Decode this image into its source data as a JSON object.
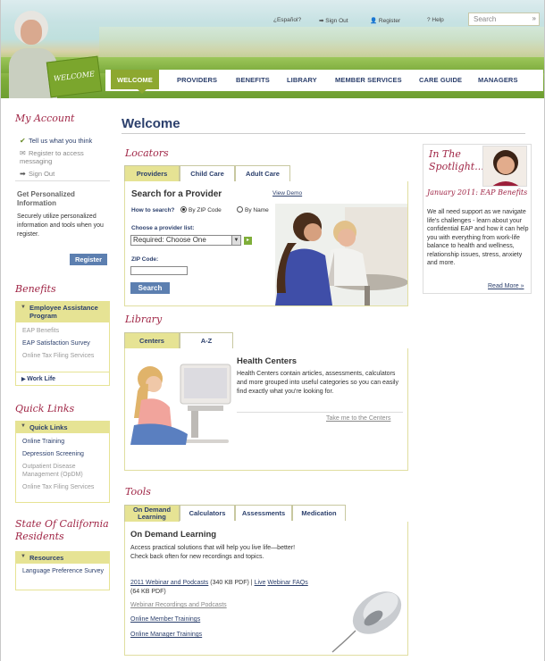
{
  "header": {
    "welcome_sign": "WELCOME",
    "utility": {
      "espanol": "¿Español?",
      "sign_out": "Sign Out",
      "register": "Register",
      "help": "Help"
    },
    "search_placeholder": "Search",
    "nav": [
      "WELCOME",
      "PROVIDERS",
      "BENEFITS",
      "LIBRARY",
      "MEMBER SERVICES",
      "CARE GUIDE",
      "MANAGERS"
    ]
  },
  "sidebar": {
    "my_account": {
      "heading": "My Account",
      "links": [
        "Tell us what you think",
        "Register to access messaging",
        "Sign Out"
      ]
    },
    "personalized": {
      "heading": "Get Personalized Information",
      "text": "Securely utilize personalized information and tools when you register.",
      "button": "Register"
    },
    "benefits": {
      "heading": "Benefits",
      "panel_title": "Employee Assistance Program",
      "links": [
        "EAP Benefits",
        "EAP Satisfaction Survey",
        "Online Tax Filing Services"
      ],
      "collapsed": "Work Life"
    },
    "quick_links": {
      "heading": "Quick Links",
      "panel_title": "Quick Links",
      "links": [
        "Online Training",
        "Depression Screening",
        "Outpatient Disease Management (OpDM)",
        "Online Tax Filing Services"
      ]
    },
    "state": {
      "heading": "State Of California Residents",
      "panel_title": "Resources",
      "links": [
        "Language Preference Survey"
      ]
    }
  },
  "main": {
    "title": "Welcome",
    "locators": {
      "heading": "Locators",
      "tabs": [
        "Providers",
        "Child Care",
        "Adult Care"
      ],
      "title": "Search for a Provider",
      "demo_link": "View Demo",
      "how_label": "How to search?",
      "radio_zip": "By ZIP Code",
      "radio_name": "By Name",
      "list_label": "Choose a provider list:",
      "select_value": "Required: Choose One",
      "zip_label": "ZIP Code:",
      "search_button": "Search"
    },
    "library": {
      "heading": "Library",
      "tabs": [
        "Centers",
        "A-Z"
      ],
      "title": "Health Centers",
      "text": "Health Centers contain articles, assessments, calculators and more grouped into useful categories so you can easily find exactly what you're looking for.",
      "link": "Take me to the Centers"
    },
    "tools": {
      "heading": "Tools",
      "tabs": [
        "On Demand Learning",
        "Calculators",
        "Assessments",
        "Medication"
      ],
      "title": "On Demand Learning",
      "text": "Access practical solutions that will help you live life—better! Check back often for new recordings and topics.",
      "link1": "2011 Webinar and Podcasts",
      "link1_meta": "(340 KB PDF) |",
      "link2a": "Live",
      "link2b": "Webinar FAQs",
      "link2_meta": "(64 KB PDF)",
      "link3": "Webinar Recordings and Podcasts",
      "link4": "Online Member Trainings",
      "link5": "Online Manager Trainings"
    }
  },
  "spotlight": {
    "heading_line1": "In The",
    "heading_line2": "Spotlight...",
    "subheading": "January 2011: EAP Benefits",
    "text": "We all need support as we navigate life's challenges - learn about your confidential EAP and how it can help you with everything from work-life balance to health and wellness, relationship issues, stress, anxiety and more.",
    "read_more": "Read More"
  }
}
